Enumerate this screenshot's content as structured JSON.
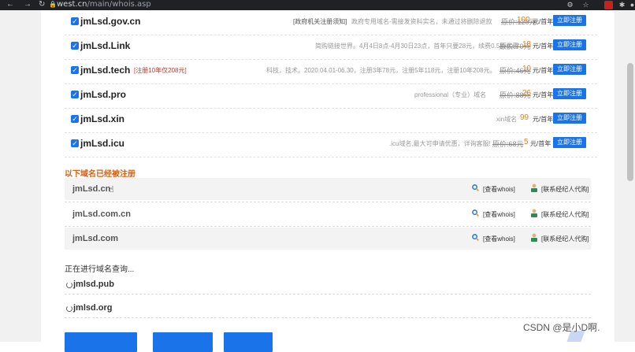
{
  "browser": {
    "url_host": "west.cn",
    "url_path": "/main/whois.asp"
  },
  "available": [
    {
      "name": "jmLsd.gov.cn",
      "promo": "",
      "desc": "[政府机关注册须知]",
      "desc2": "政府专用域名-需接发资料实名，未通过将删除退款",
      "orig": "原价:120元",
      "price": "100",
      "unit": "元/首年",
      "button": "立即注册"
    },
    {
      "name": "jmLsd.Link",
      "promo": "",
      "desc": "简购链接世界。4月4日8点-4月30日23点，首年只要28元，续费0.5折优惠",
      "orig": "原价:70元",
      "price": "18",
      "unit": "元/首年",
      "button": "立即注册"
    },
    {
      "name": "jmLsd.tech",
      "promo": "[注册10年仅208元]",
      "desc": "科技，技术。2020.04.01-06.30，注册3年78元，注册5年118元，注册10年208元。",
      "orig": "原价:46元",
      "price": "10",
      "unit": "元/首年",
      "button": "立即注册"
    },
    {
      "name": "jmLsd.pro",
      "promo": "",
      "desc": "professional（专业）域名",
      "orig": "原价:88元",
      "price": "26",
      "unit": "元/首年",
      "button": "立即注册"
    },
    {
      "name": "jmLsd.xin",
      "promo": "",
      "desc": "xin域名",
      "orig": "",
      "price": "99",
      "unit": "元/首年",
      "button": "立即注册"
    },
    {
      "name": "jmLsd.icu",
      "promo": "",
      "desc": ".icu域名,最大可申请优惠，详询客服!",
      "orig": "原价:68元",
      "price": "5",
      "unit": "元/首年",
      "button": "立即注册"
    }
  ],
  "registered_title": "以下域名已经被注册",
  "registered": [
    {
      "name": "jmLsd.cn",
      "whois": "[查看whois]",
      "agent": "[联系经纪人代购]"
    },
    {
      "name": "jmLsd.com.cn",
      "whois": "[查看whois]",
      "agent": "[联系经纪人代购]"
    },
    {
      "name": "jmLsd.com",
      "whois": "[查看whois]",
      "agent": "[联系经纪人代购]"
    }
  ],
  "querying_title": "正在进行域名查询...",
  "querying": [
    {
      "name": "jmlsd.pub"
    },
    {
      "name": "jmlsd.org"
    }
  ],
  "watermark": "CSDN @是小D啊.",
  "colors": {
    "accent": "#1a73e8",
    "section": "#e05a0c",
    "price": "#e67e22"
  }
}
